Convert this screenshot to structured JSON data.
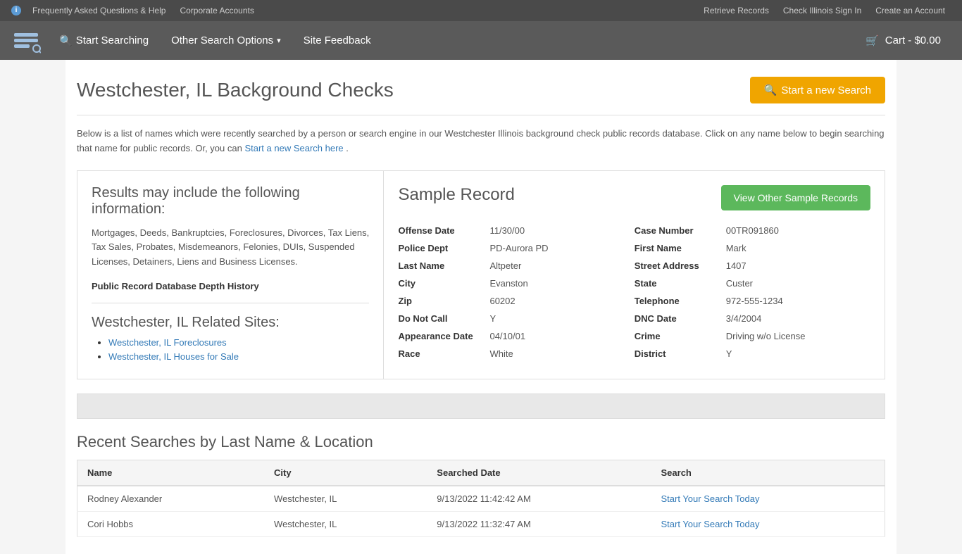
{
  "utility_bar": {
    "left": {
      "info_icon": "i",
      "faq_label": "Frequently Asked Questions & Help",
      "corporate_label": "Corporate Accounts"
    },
    "right": {
      "retrieve_label": "Retrieve Records",
      "signin_label": "Check Illinois Sign In",
      "create_label": "Create an Account"
    }
  },
  "nav": {
    "logo_alt": "CheckIllinois Logo",
    "start_searching": "Start Searching",
    "other_search_options": "Other Search Options",
    "site_feedback": "Site Feedback",
    "cart_label": "Cart - $0.00"
  },
  "page": {
    "title": "Westchester, IL Background Checks",
    "start_new_search_btn": "Start a new Search",
    "intro_text": "Below is a list of names which were recently searched by a person or search engine in our Westchester Illinois background check public records database. Click on any name below to begin searching that name for public records. Or, you can",
    "intro_link": "Start a new Search here",
    "intro_period": "."
  },
  "left_col": {
    "results_heading": "Results may include the following information:",
    "results_text": "Mortgages, Deeds, Bankruptcies, Foreclosures, Divorces, Tax Liens, Tax Sales, Probates, Misdemeanors, Felonies, DUIs, Suspended Licenses, Detainers, Liens and Business Licenses.",
    "db_history_label": "Public Record Database Depth History",
    "related_heading": "Westchester, IL Related Sites:",
    "related_links": [
      {
        "label": "Westchester, IL Foreclosures",
        "url": "#"
      },
      {
        "label": "Westchester, IL Houses for Sale",
        "url": "#"
      }
    ]
  },
  "sample_record": {
    "heading": "Sample Record",
    "view_other_btn": "View Other Sample Records",
    "fields_left": [
      {
        "label": "Offense Date",
        "value": "11/30/00"
      },
      {
        "label": "Police Dept",
        "value": "PD-Aurora PD"
      },
      {
        "label": "Last Name",
        "value": "Altpeter"
      },
      {
        "label": "City",
        "value": "Evanston"
      },
      {
        "label": "Zip",
        "value": "60202"
      },
      {
        "label": "Do Not Call",
        "value": "Y"
      },
      {
        "label": "Appearance Date",
        "value": "04/10/01"
      },
      {
        "label": "Race",
        "value": "White"
      }
    ],
    "fields_right": [
      {
        "label": "Case Number",
        "value": "00TR091860"
      },
      {
        "label": "First Name",
        "value": "Mark"
      },
      {
        "label": "Street Address",
        "value": "1407"
      },
      {
        "label": "State",
        "value": "Custer"
      },
      {
        "label": "Telephone",
        "value": "972-555-1234"
      },
      {
        "label": "DNC Date",
        "value": "3/4/2004"
      },
      {
        "label": "Crime",
        "value": "Driving w/o License"
      },
      {
        "label": "District",
        "value": "Y"
      }
    ]
  },
  "recent_searches": {
    "heading": "Recent Searches by Last Name & Location",
    "columns": [
      "Name",
      "City",
      "Searched Date",
      "Search"
    ],
    "rows": [
      {
        "name": "Rodney Alexander",
        "city": "Westchester, IL",
        "date": "9/13/2022 11:42:42 AM",
        "search_label": "Start Your Search Today"
      },
      {
        "name": "Cori Hobbs",
        "city": "Westchester, IL",
        "date": "9/13/2022 11:32:47 AM",
        "search_label": "Start Your Search Today"
      }
    ]
  }
}
